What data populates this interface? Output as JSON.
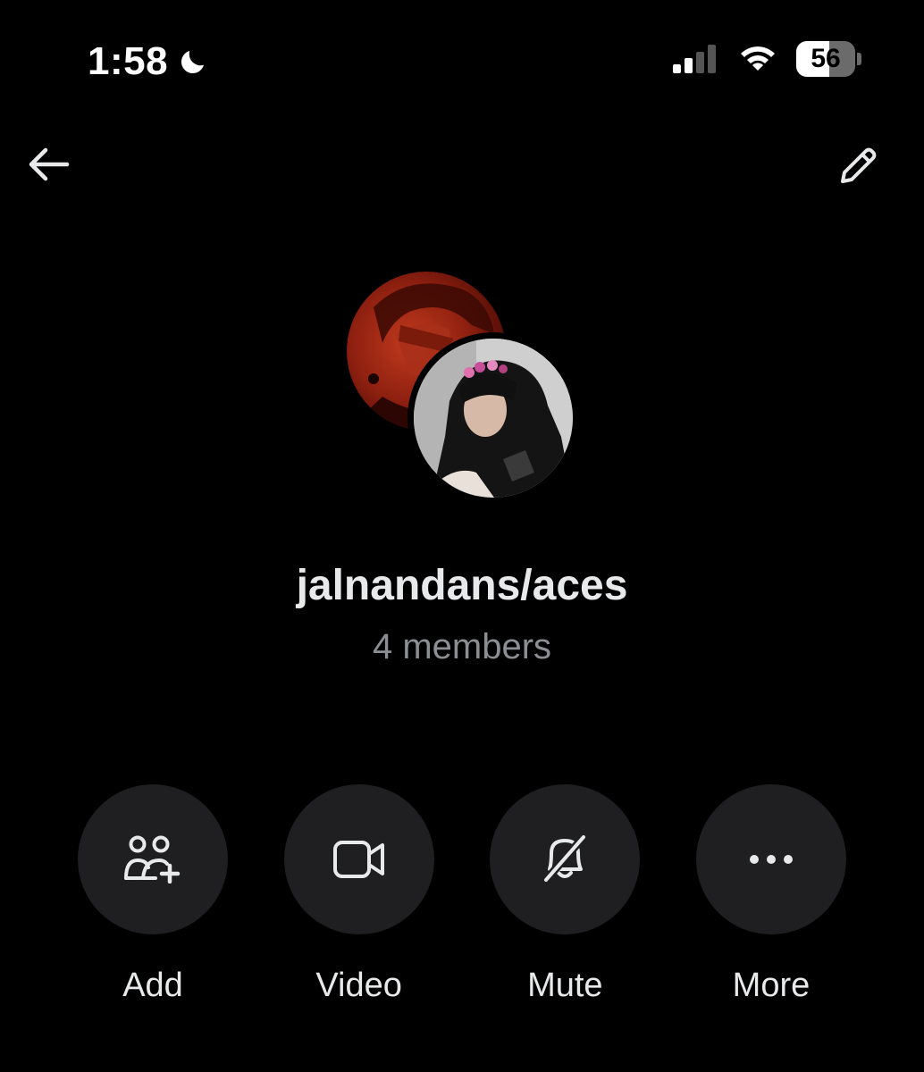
{
  "status_bar": {
    "time": "1:58",
    "battery": "56",
    "battery_level": 0.56,
    "icons": [
      "moon-icon",
      "signal-icon",
      "wifi-icon",
      "battery-icon"
    ]
  },
  "nav": {
    "back_icon": "arrow-left-icon",
    "edit_icon": "pencil-icon"
  },
  "group": {
    "name": "jalnandans/aces",
    "members": "4 members"
  },
  "actions": [
    {
      "label": "Add",
      "icon": "add-people-icon"
    },
    {
      "label": "Video",
      "icon": "video-camera-icon"
    },
    {
      "label": "Mute",
      "icon": "bell-off-icon"
    },
    {
      "label": "More",
      "icon": "more-dots-icon"
    }
  ],
  "colors": {
    "background": "#000000",
    "button_bg": "#1f1f21",
    "text_primary": "#e7e9ea",
    "text_secondary": "#8b8f94"
  }
}
